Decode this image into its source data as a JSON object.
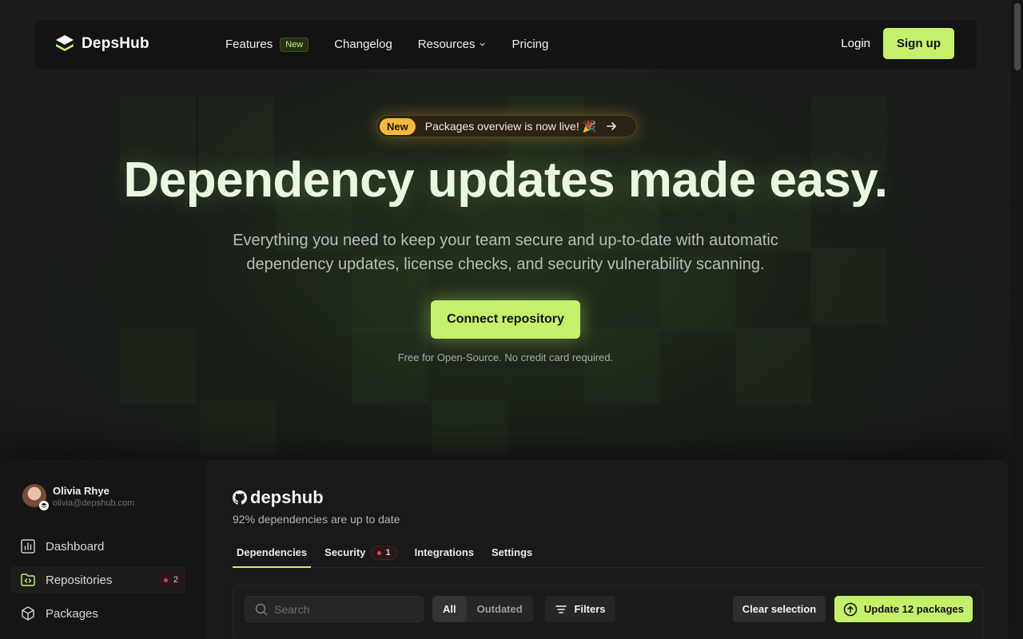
{
  "nav": {
    "brand": "DepsHub",
    "links": [
      {
        "label": "Features",
        "badge": "New"
      },
      {
        "label": "Changelog"
      },
      {
        "label": "Resources"
      },
      {
        "label": "Pricing"
      }
    ],
    "login": "Login",
    "signup": "Sign up"
  },
  "hero": {
    "announce_badge": "New",
    "announce_text": "Packages overview is now live! 🎉",
    "title": "Dependency updates made easy.",
    "subtitle": "Everything you need to keep your team secure and up-to-date with automatic dependency updates, license checks, and security vulnerability scanning.",
    "cta": "Connect repository",
    "note": "Free for Open-Source. No credit card required."
  },
  "app": {
    "user": {
      "name": "Olivia Rhye",
      "email": "olivia@depshub.com"
    },
    "sidebar": [
      {
        "label": "Dashboard",
        "icon": "bar-chart-icon"
      },
      {
        "label": "Repositories",
        "icon": "folder-code-icon",
        "count": "2"
      },
      {
        "label": "Packages",
        "icon": "package-icon"
      }
    ],
    "repo": {
      "name": "depshub",
      "status": "92% dependencies are up to date"
    },
    "tabs": [
      {
        "label": "Dependencies"
      },
      {
        "label": "Security",
        "badge": "1"
      },
      {
        "label": "Integrations"
      },
      {
        "label": "Settings"
      }
    ],
    "toolbar": {
      "search_placeholder": "Search",
      "segments": [
        "All",
        "Outdated"
      ],
      "filters": "Filters",
      "clear": "Clear selection",
      "update": "Update 12 packages"
    }
  },
  "colors": {
    "accent": "#c5f06b",
    "background": "#141514",
    "alert": "#e0413f",
    "announce": "#f5b93a"
  }
}
